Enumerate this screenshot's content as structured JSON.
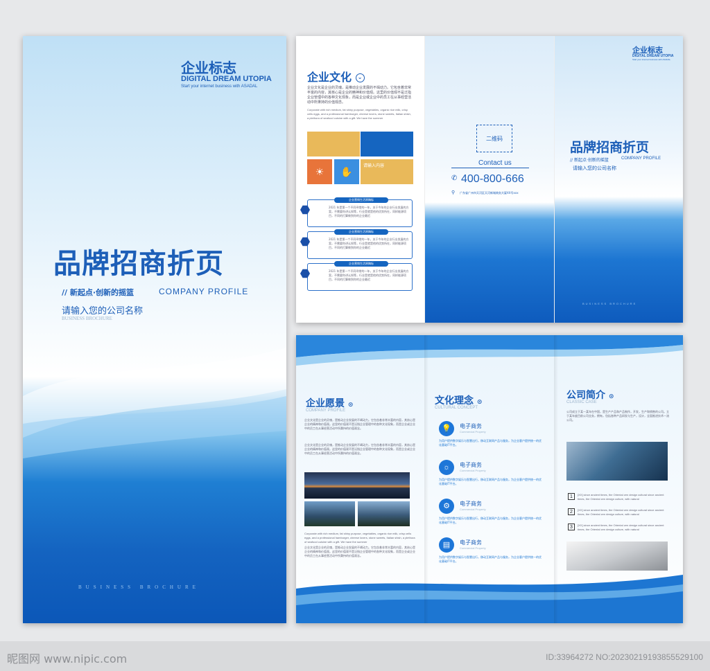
{
  "cover": {
    "logo": "企业标志",
    "brand": "DIGITAL DREAM UTOPIA",
    "tagline": "Start your internet business with ASADAL",
    "title": "品牌招商折页",
    "slogan": "// 新起点·创新的摇篮",
    "profile": "COMPANY PROFILE",
    "company": "请输入您的公司名称",
    "brochure_small": "BUSINESS BROCHURE",
    "footer": "BUSINESS   BROCHURE"
  },
  "inner": {
    "culture_title": "企业文化",
    "culture_text": "企业文化是企业的灵魂，是推动企业发展的不竭动力。它包含着非常丰富的内容，其核心是企业的精神和价值观。这里的价值观不是泛指企业管理中的各种文化现象，而是企业或企业中的员工在从事经营活动中所秉持的价值观念。",
    "culture_en": "Corporate with rich medium, fat shiny purpose, vegetables, organic rice milk, crisp cells eggs, and a professional hamburger, cheese lovers, stone sweets, Italian shish, a plethora of seafood cuisine with a gift. We have the summer",
    "tile_label": "请输入内容",
    "list": [
      {
        "heading": "企业营销生活原稿标",
        "text": "2021 年是第一个不同寻常的一年，关于今年的企业行业发展的方案，不需要你讲认知等，行业是就是他的优势所在，同样能源项目，不同的打算做到你的企业最迟"
      },
      {
        "heading": "企业营销生活原稿标",
        "text": "2021 年是第一个不同寻常的一年，关于今年的企业行业发展的方案，不需要你讲认知等，行业是就是他的优势所在，同样能源项目，不同的打算做到你的企业最迟"
      },
      {
        "heading": "企业营销生活原稿标",
        "text": "2021 年是第一个不同寻常的一年，关于今年的企业行业发展的方案，不需要你讲认知等，行业是就是他的优势所在，同样能源项目，不同的打算做到你的企业最迟"
      }
    ],
    "qr": "二维码",
    "contact": "Contact us",
    "phone": "400-800-666",
    "address": "广东省广州市天河区天河新城商务大厦XX号xxx",
    "right_logo": "企业标志",
    "right_brand": "DIGITAL DREAM UTOPIA",
    "right_tagline": "Start your internet business with ASADAL",
    "right_title": "品牌招商折页",
    "right_slogan": "// 新起点·创新的摇篮",
    "right_profile": "COMPANY PROFILE",
    "right_company": "请输入您的公司名称",
    "right_footer": "BUSINESS BROCHURE"
  },
  "outer": {
    "vision_title": "企业愿景",
    "vision_en": "COMPANY PROFILE",
    "vision_text1": "企业文化是企业的灵魂，是推动企业发展的不竭动力。它包含着非常丰富的内容，其核心是企业的精神和价值观。这里的价值观不是泛指企业管理中的各种文化现象，而是企业或企业中的员工在从事经营活动中所秉持的价值观念。",
    "vision_text2": "企业文化是企业的灵魂，是推动企业发展的不竭动力，它包含着非常丰富的内容，其核心是企业的精神和价值观。这里的价值观不是泛指企业管理中的各种文化现象，而是企业或企业中的员工在从事经营活动中所秉持的价值观念。",
    "vision_en2": "Corporate with rich medium, fat shiny purpose, vegetables, organic rice milk, crisp cells eggs, and a professional hamburger, cheese lovers, stone sweets, Italian shish, a plethora of seafood cuisine with a gift. We have the summer",
    "vision_text3": "企业文化是企业的灵魂，是推动企业发展的不竭动力。它包含着非常丰富的内容，其核心是企业的精神和价值观。这里的价值观不是泛指企业管理中的各种文化现象，而是企业或企业中的员工在从事经营活动中所秉持的价值观念。",
    "concept_title": "文化理念",
    "concept_en": "CULTURAL CONCEPT",
    "items": [
      {
        "title": "电子商务",
        "en": "Commercial Property",
        "text": "为用户提供数字娱乐与智慧出行，移动互联网产品与服务，为企业客户提供统一的优化基础IT平台。"
      },
      {
        "title": "电子商务",
        "en": "Commercial Property",
        "text": "为用户提供数字娱乐与智慧出行，移动互联网产品与服务，为企业客户提供统一的优化基础IT平台。"
      },
      {
        "title": "电子商务",
        "en": "Commercial Property",
        "text": "为用户提供数字娱乐与智慧出行，移动互联网产品与服务，为企业客户提供统一的优化基础IT平台。"
      },
      {
        "title": "电子商务",
        "en": "Commercial Property",
        "text": "为用户提供数字娱乐与智慧出行，移动互联网产品与服务，为企业客户提供统一的优化基础IT平台。"
      }
    ],
    "intro_title": "公司简介",
    "intro_en": "CLASSIC CASE",
    "intro_text": "公司成立于某一某年在中国，是生产产品和产品制作，开发，生产和销售的公司。立于某年度目前公司业务，拥有，包括各种产品研发与生产，设计，全面推进技术一流公司。",
    "numbered": [
      {
        "n": "1",
        "text": "[XX] since ancient times, the Oriental zen design cultural since ancient times, the Oriental zen design culture, with natural"
      },
      {
        "n": "2",
        "text": "[XX] since ancient times, the Oriental zen design cultural since ancient times, the Oriental zen design culture, with natural"
      },
      {
        "n": "3",
        "text": "[XX] since ancient times, the Oriental zen design cultural since ancient times, the Oriental zen design culture, with natural"
      }
    ]
  },
  "watermark": {
    "left": "昵图网 www.nipic.com",
    "right": "ID:33964272 NO:20230219193855529100"
  },
  "colors": {
    "brand_blue": "#1565c0",
    "title_blue": "#1d5fb8",
    "yellow": "#e9b95a",
    "orange": "#e8743a",
    "light_blue": "#3b8fe0"
  }
}
